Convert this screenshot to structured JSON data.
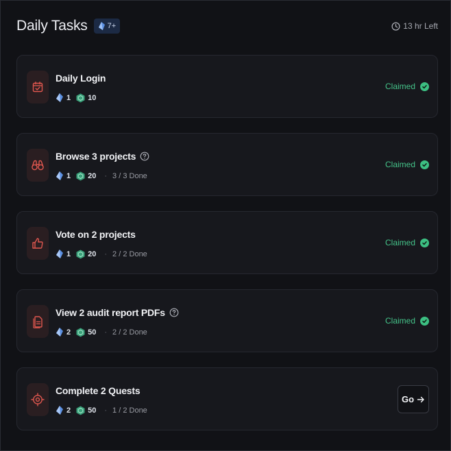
{
  "header": {
    "title": "Daily Tasks",
    "badge_text": "7+",
    "time_left": "13 hr Left"
  },
  "colors": {
    "claimed": "#45c48a",
    "icon_accent": "#e0574f",
    "gem": "#5b8fe0",
    "token": "#3aa07a"
  },
  "tasks": [
    {
      "icon": "calendar-check-icon",
      "title": "Daily Login",
      "gems": "1",
      "points": "10",
      "progress": "",
      "status": "Claimed",
      "has_help": false
    },
    {
      "icon": "binoculars-icon",
      "title": "Browse 3 projects",
      "gems": "1",
      "points": "20",
      "progress": "3 / 3 Done",
      "status": "Claimed",
      "has_help": true
    },
    {
      "icon": "thumbs-up-icon",
      "title": "Vote on 2 projects",
      "gems": "1",
      "points": "20",
      "progress": "2 / 2 Done",
      "status": "Claimed",
      "has_help": false
    },
    {
      "icon": "document-icon",
      "title": "View 2 audit report PDFs",
      "gems": "2",
      "points": "50",
      "progress": "2 / 2 Done",
      "status": "Claimed",
      "has_help": true
    },
    {
      "icon": "target-icon",
      "title": "Complete 2 Quests",
      "gems": "2",
      "points": "50",
      "progress": "1 / 2 Done",
      "status": "Go",
      "has_help": false
    }
  ]
}
